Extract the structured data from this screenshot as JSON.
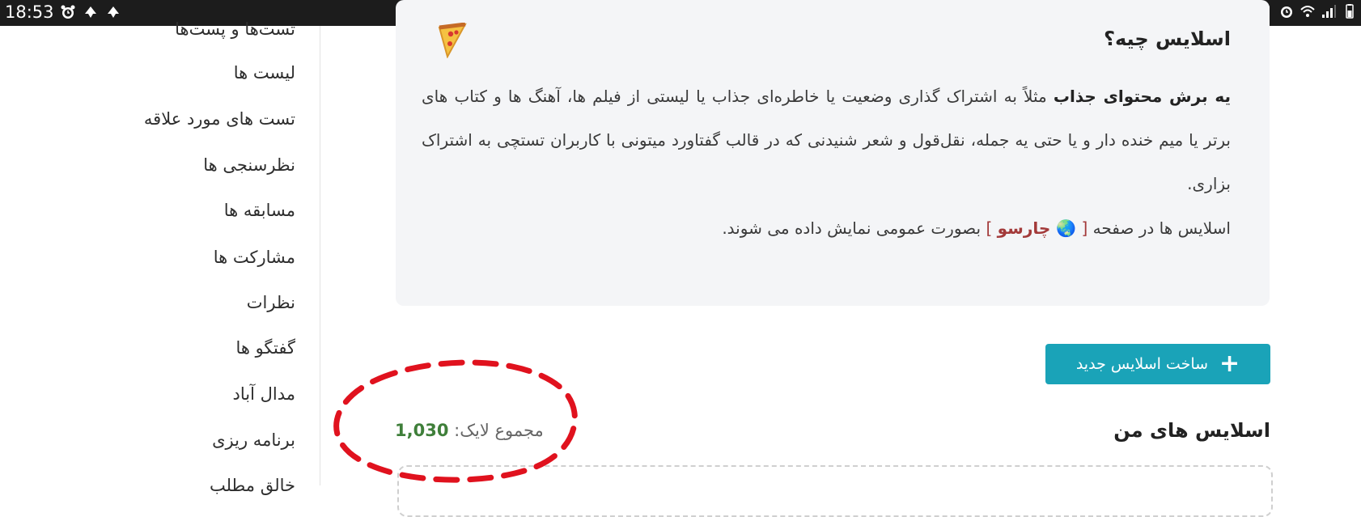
{
  "status_bar": {
    "time": "18:53",
    "left_icons": [
      "alarm-icon",
      "notification-icon",
      "notification-icon"
    ],
    "right_icons": [
      "sim-icon",
      "alarm-icon",
      "wifi-icon",
      "signal-icon",
      "battery-icon"
    ]
  },
  "sidebar": {
    "items": [
      {
        "label": "تست‌ها و پست‌ها"
      },
      {
        "label": "لیست ها"
      },
      {
        "label": "تست های مورد علاقه"
      },
      {
        "label": "نظرسنجی ها"
      },
      {
        "label": "مسابقه ها"
      },
      {
        "label": "مشارکت ها"
      },
      {
        "label": "نظرات"
      },
      {
        "label": "گفتگو ها"
      },
      {
        "label": "مدال آباد"
      },
      {
        "label": "برنامه ریزی"
      },
      {
        "label": "خالق مطلب"
      }
    ]
  },
  "info_card": {
    "title": "اسلایس چیه؟",
    "emoji": "🍕",
    "para1_bold": "یه برش محتوای جذاب",
    "para1_rest": " مثلاً به اشتراک گذاری وضعیت یا خاطره‌ای جذاب یا لیستی از فیلم ها، آهنگ ها و کتاب های برتر یا میم خنده دار و یا حتی یه جمله، نقل‌قول و شعر شنیدنی که در قالب گفتاورد میتونی با کاربران تستچی به اشتراک بزاری.",
    "para2_prefix": "اسلایس ها در صفحه ",
    "para2_bracket_open": "[ ",
    "para2_globe": "🌏",
    "para2_link": " چارسو",
    "para2_bracket_close": " ]",
    "para2_suffix": " بصورت عمومی نمایش داده می شوند."
  },
  "new_slice_button": {
    "label": "ساخت اسلایس جدید",
    "icon": "plus-icon"
  },
  "my_slices": {
    "title": "اسلایس های من"
  },
  "likes": {
    "label": "مجموع لایک: ",
    "value": "1,030"
  },
  "colors": {
    "button_bg": "#1aa3b8",
    "likes_value": "#3f7f3a",
    "link": "#a33a3a",
    "annotation": "#e0121e",
    "card_bg": "#f4f5f7"
  }
}
